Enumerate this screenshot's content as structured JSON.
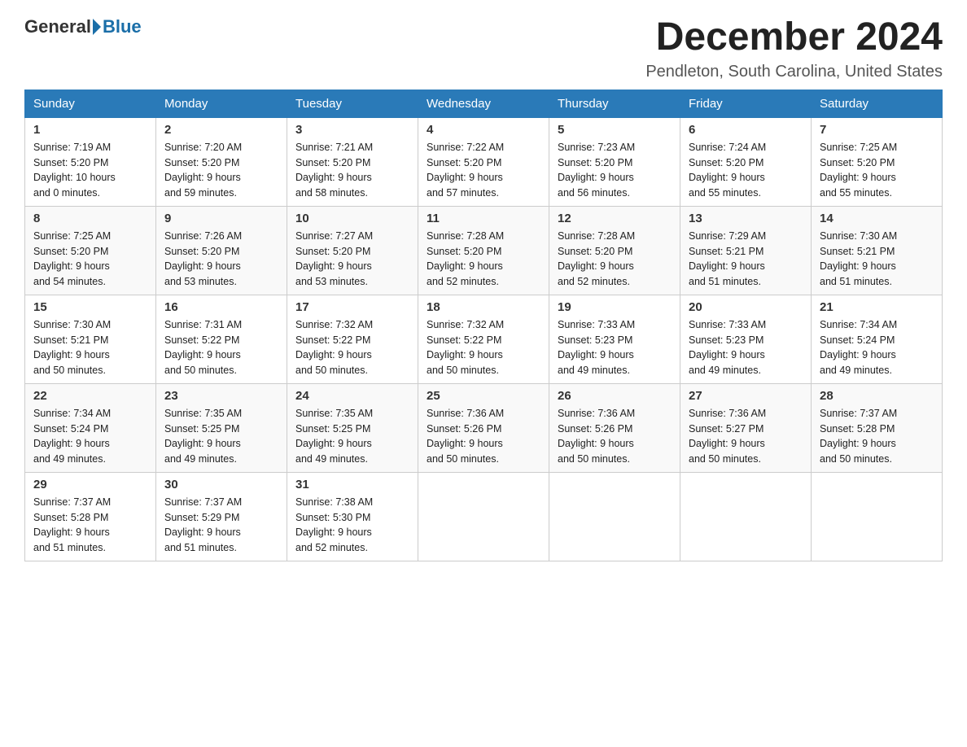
{
  "header": {
    "logo_general": "General",
    "logo_blue": "Blue",
    "month_title": "December 2024",
    "location": "Pendleton, South Carolina, United States"
  },
  "days_of_week": [
    "Sunday",
    "Monday",
    "Tuesday",
    "Wednesday",
    "Thursday",
    "Friday",
    "Saturday"
  ],
  "weeks": [
    [
      {
        "num": "1",
        "sunrise": "7:19 AM",
        "sunset": "5:20 PM",
        "daylight": "10 hours and 0 minutes."
      },
      {
        "num": "2",
        "sunrise": "7:20 AM",
        "sunset": "5:20 PM",
        "daylight": "9 hours and 59 minutes."
      },
      {
        "num": "3",
        "sunrise": "7:21 AM",
        "sunset": "5:20 PM",
        "daylight": "9 hours and 58 minutes."
      },
      {
        "num": "4",
        "sunrise": "7:22 AM",
        "sunset": "5:20 PM",
        "daylight": "9 hours and 57 minutes."
      },
      {
        "num": "5",
        "sunrise": "7:23 AM",
        "sunset": "5:20 PM",
        "daylight": "9 hours and 56 minutes."
      },
      {
        "num": "6",
        "sunrise": "7:24 AM",
        "sunset": "5:20 PM",
        "daylight": "9 hours and 55 minutes."
      },
      {
        "num": "7",
        "sunrise": "7:25 AM",
        "sunset": "5:20 PM",
        "daylight": "9 hours and 55 minutes."
      }
    ],
    [
      {
        "num": "8",
        "sunrise": "7:25 AM",
        "sunset": "5:20 PM",
        "daylight": "9 hours and 54 minutes."
      },
      {
        "num": "9",
        "sunrise": "7:26 AM",
        "sunset": "5:20 PM",
        "daylight": "9 hours and 53 minutes."
      },
      {
        "num": "10",
        "sunrise": "7:27 AM",
        "sunset": "5:20 PM",
        "daylight": "9 hours and 53 minutes."
      },
      {
        "num": "11",
        "sunrise": "7:28 AM",
        "sunset": "5:20 PM",
        "daylight": "9 hours and 52 minutes."
      },
      {
        "num": "12",
        "sunrise": "7:28 AM",
        "sunset": "5:20 PM",
        "daylight": "9 hours and 52 minutes."
      },
      {
        "num": "13",
        "sunrise": "7:29 AM",
        "sunset": "5:21 PM",
        "daylight": "9 hours and 51 minutes."
      },
      {
        "num": "14",
        "sunrise": "7:30 AM",
        "sunset": "5:21 PM",
        "daylight": "9 hours and 51 minutes."
      }
    ],
    [
      {
        "num": "15",
        "sunrise": "7:30 AM",
        "sunset": "5:21 PM",
        "daylight": "9 hours and 50 minutes."
      },
      {
        "num": "16",
        "sunrise": "7:31 AM",
        "sunset": "5:22 PM",
        "daylight": "9 hours and 50 minutes."
      },
      {
        "num": "17",
        "sunrise": "7:32 AM",
        "sunset": "5:22 PM",
        "daylight": "9 hours and 50 minutes."
      },
      {
        "num": "18",
        "sunrise": "7:32 AM",
        "sunset": "5:22 PM",
        "daylight": "9 hours and 50 minutes."
      },
      {
        "num": "19",
        "sunrise": "7:33 AM",
        "sunset": "5:23 PM",
        "daylight": "9 hours and 49 minutes."
      },
      {
        "num": "20",
        "sunrise": "7:33 AM",
        "sunset": "5:23 PM",
        "daylight": "9 hours and 49 minutes."
      },
      {
        "num": "21",
        "sunrise": "7:34 AM",
        "sunset": "5:24 PM",
        "daylight": "9 hours and 49 minutes."
      }
    ],
    [
      {
        "num": "22",
        "sunrise": "7:34 AM",
        "sunset": "5:24 PM",
        "daylight": "9 hours and 49 minutes."
      },
      {
        "num": "23",
        "sunrise": "7:35 AM",
        "sunset": "5:25 PM",
        "daylight": "9 hours and 49 minutes."
      },
      {
        "num": "24",
        "sunrise": "7:35 AM",
        "sunset": "5:25 PM",
        "daylight": "9 hours and 49 minutes."
      },
      {
        "num": "25",
        "sunrise": "7:36 AM",
        "sunset": "5:26 PM",
        "daylight": "9 hours and 50 minutes."
      },
      {
        "num": "26",
        "sunrise": "7:36 AM",
        "sunset": "5:26 PM",
        "daylight": "9 hours and 50 minutes."
      },
      {
        "num": "27",
        "sunrise": "7:36 AM",
        "sunset": "5:27 PM",
        "daylight": "9 hours and 50 minutes."
      },
      {
        "num": "28",
        "sunrise": "7:37 AM",
        "sunset": "5:28 PM",
        "daylight": "9 hours and 50 minutes."
      }
    ],
    [
      {
        "num": "29",
        "sunrise": "7:37 AM",
        "sunset": "5:28 PM",
        "daylight": "9 hours and 51 minutes."
      },
      {
        "num": "30",
        "sunrise": "7:37 AM",
        "sunset": "5:29 PM",
        "daylight": "9 hours and 51 minutes."
      },
      {
        "num": "31",
        "sunrise": "7:38 AM",
        "sunset": "5:30 PM",
        "daylight": "9 hours and 52 minutes."
      },
      null,
      null,
      null,
      null
    ]
  ],
  "labels": {
    "sunrise": "Sunrise:",
    "sunset": "Sunset:",
    "daylight": "Daylight:"
  }
}
